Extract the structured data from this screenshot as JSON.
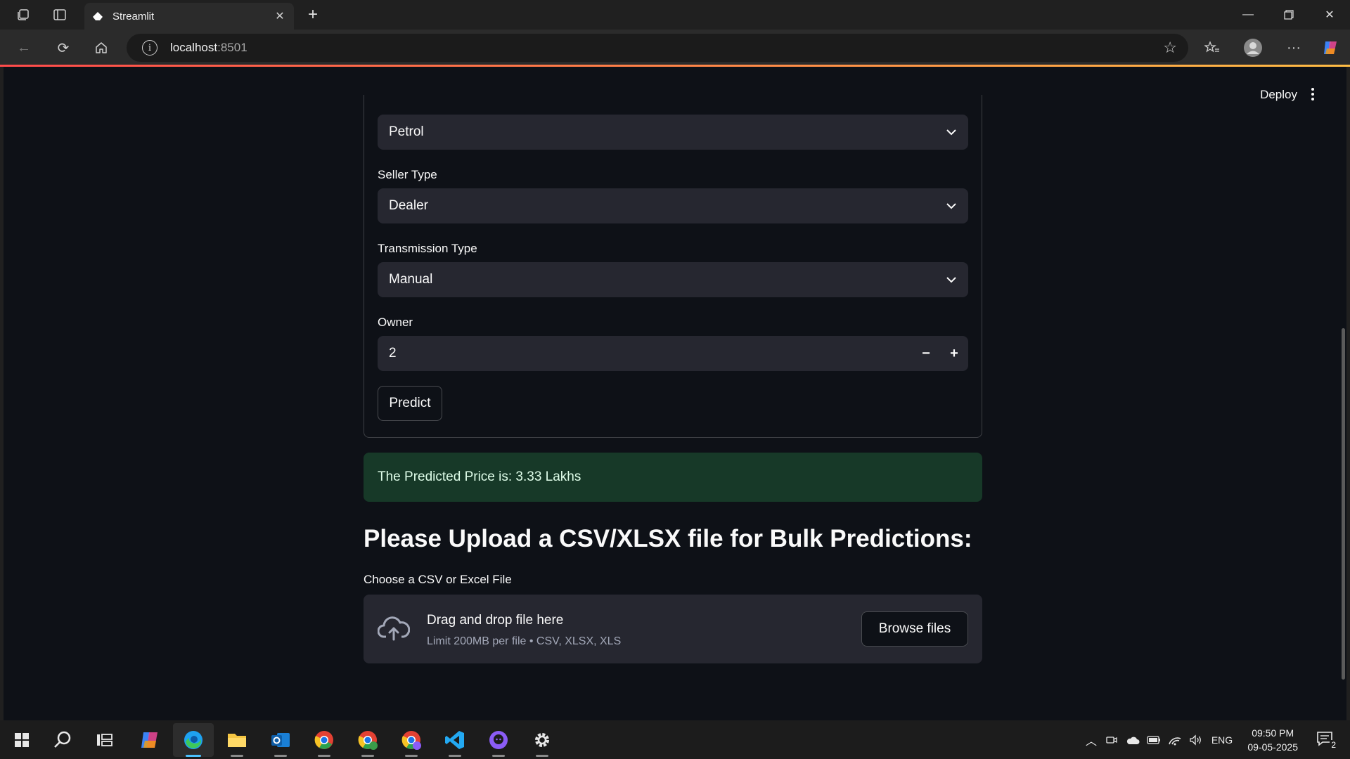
{
  "browser": {
    "tab_title": "Streamlit",
    "url_host": "localhost",
    "url_port": ":8501"
  },
  "app": {
    "deploy_label": "Deploy",
    "fuel_select_value": "Petrol",
    "seller_type_label": "Seller Type",
    "seller_type_value": "Dealer",
    "transmission_label": "Transmission Type",
    "transmission_value": "Manual",
    "owner_label": "Owner",
    "owner_value": "2",
    "decrement_symbol": "−",
    "increment_symbol": "+",
    "predict_button": "Predict",
    "prediction_message": "The Predicted Price is: 3.33 Lakhs",
    "upload_heading": "Please Upload a CSV/XLSX file for Bulk Predictions:",
    "uploader_label": "Choose a CSV or Excel File",
    "dropzone_title": "Drag and drop file here",
    "dropzone_limit": "Limit 200MB per file • CSV, XLSX, XLS",
    "browse_button": "Browse files"
  },
  "taskbar": {
    "language": "ENG",
    "time": "09:50 PM",
    "date": "09-05-2025",
    "notification_count": "2"
  },
  "colors": {
    "app_background": "#0e1117",
    "input_background": "#262730",
    "success_background": "#173928",
    "accent": "#ff4b4b"
  }
}
